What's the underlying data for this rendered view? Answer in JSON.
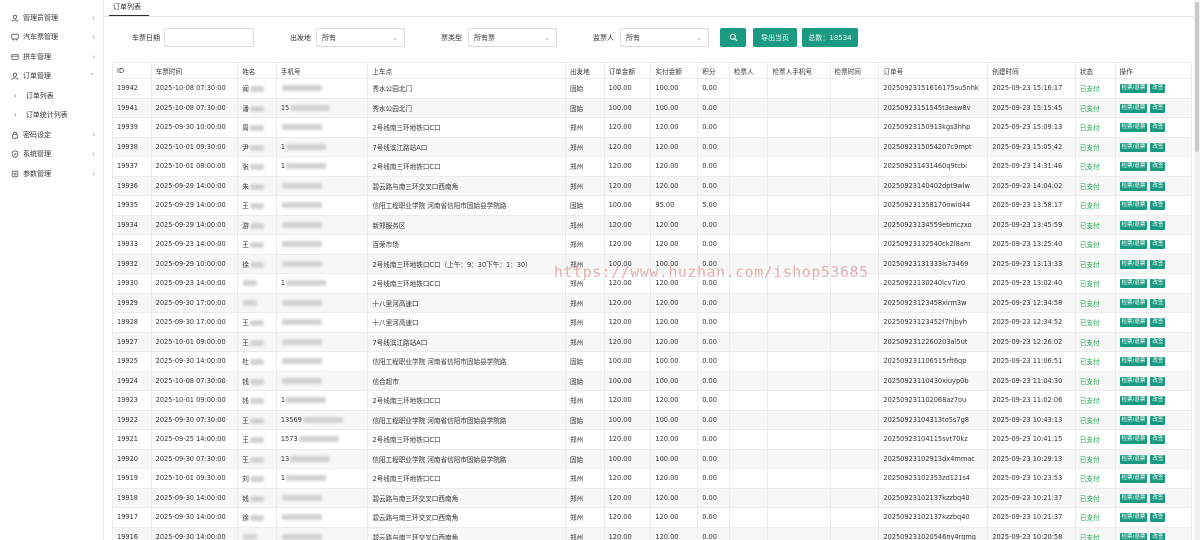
{
  "sidebar": {
    "items": [
      {
        "label": "管理员管理",
        "icon": "admin-icon",
        "arrow": "›"
      },
      {
        "label": "汽车票管理",
        "icon": "bus-icon",
        "arrow": "›"
      },
      {
        "label": "拼车管理",
        "icon": "carpool-icon",
        "arrow": "›"
      },
      {
        "label": "订单管理",
        "icon": "order-icon",
        "arrow": "⌃"
      }
    ],
    "sub_items": [
      {
        "label": "订单列表",
        "arrow": "›"
      },
      {
        "label": "订单统计列表",
        "arrow": "›"
      }
    ],
    "items_after": [
      {
        "label": "密码设定",
        "icon": "lock-icon",
        "arrow": "›"
      },
      {
        "label": "系统管理",
        "icon": "shield-icon",
        "arrow": "›"
      },
      {
        "label": "参数管理",
        "icon": "settings-icon",
        "arrow": "›"
      }
    ]
  },
  "tabs": {
    "active": "订单列表"
  },
  "filters": {
    "date_label": "车票日期",
    "origin_label": "出发地",
    "origin_value": "所有",
    "ticket_type_label": "票类型",
    "ticket_type_value": "所有票",
    "inspector_label": "监票人",
    "inspector_value": "所有",
    "export_label": "导出当页",
    "total_label": "总数：18534"
  },
  "table": {
    "columns": [
      "ID",
      "车票时间",
      "姓名",
      "手机号",
      "上车点",
      "出发地",
      "订单金额",
      "实付金额",
      "积分",
      "检票人",
      "检票人手机号",
      "检票时间",
      "订单号",
      "创建时间",
      "状态",
      "操作"
    ],
    "action_check": "检票/退票",
    "action_edit": "改签",
    "rows": [
      {
        "id": "19942",
        "time": "2025-10-08 07:30:00",
        "name": "闻",
        "phone": "",
        "stop": "秀水公园北门",
        "origin": "固始",
        "amount": "100.00",
        "paid": "100.00",
        "points": "0.00",
        "order": "20250923151616175su5nhk",
        "created": "2025-09-23 15:16:17",
        "status": "已支付"
      },
      {
        "id": "19941",
        "time": "2025-10-08 07:30:00",
        "name": "潘",
        "phone": "15",
        "stop": "秀水公园北门",
        "origin": "固始",
        "amount": "100.00",
        "paid": "100.00",
        "points": "0.00",
        "order": "2025092315154​5t3eaw8v",
        "created": "2025-09-23 15:15:45",
        "status": "已支付"
      },
      {
        "id": "19939",
        "time": "2025-09-30 10:00:00",
        "name": "周",
        "phone": "",
        "stop": "2号线南三环地铁口C口",
        "origin": "郑州",
        "amount": "120.00",
        "paid": "120.00",
        "points": "0.00",
        "order": "202509231509​13kgs3hhp",
        "created": "2025-09-23 15:09:13",
        "status": "已支付"
      },
      {
        "id": "19938",
        "time": "2025-10-01 09:30:00",
        "name": "尹",
        "phone": "1",
        "stop": "7号线滨江路站A口",
        "origin": "郑州",
        "amount": "120.00",
        "paid": "120.00",
        "points": "0.00",
        "order": "20250923150542​07c9mpt",
        "created": "2025-09-23 15:05:42",
        "status": "已支付"
      },
      {
        "id": "19937",
        "time": "2025-10-01 08:00:00",
        "name": "张",
        "phone": "1",
        "stop": "2号线南三环地铁口C口",
        "origin": "郑州",
        "amount": "120.00",
        "paid": "120.00",
        "points": "0.00",
        "order": "20250923143146​0q9tcbi",
        "created": "2025-09-23 14:31:46",
        "status": "已支付"
      },
      {
        "id": "19936",
        "time": "2025-09-29 14:00:00",
        "name": "朱",
        "phone": "",
        "stop": "碧云路与南三环交叉口西南角",
        "origin": "郑州",
        "amount": "120.00",
        "paid": "120.00",
        "points": "0.00",
        "order": "20250923140402dpt9wlw",
        "created": "2025-09-23 14:04:02",
        "status": "已支付"
      },
      {
        "id": "19935",
        "time": "2025-09-29 14:00:00",
        "name": "王",
        "phone": "",
        "stop": "信阳工程职业学院 河南省信阳市固始县学院路",
        "origin": "固始",
        "amount": "100.00",
        "paid": "95.00",
        "points": "5.00",
        "order": "20250923135817​0owid44",
        "created": "2025-09-23 13:58:17",
        "status": "已支付"
      },
      {
        "id": "19934",
        "time": "2025-09-29 14:00:00",
        "name": "游",
        "phone": "",
        "stop": "新郑服务区",
        "origin": "郑州",
        "amount": "120.00",
        "paid": "120.00",
        "points": "0.00",
        "order": "20250923134559ebmczxo",
        "created": "2025-09-23 13:45:59",
        "status": "已支付"
      },
      {
        "id": "19933",
        "time": "2025-09-23 14:00:00",
        "name": "王",
        "phone": "",
        "stop": "百荣市场",
        "origin": "郑州",
        "amount": "120.00",
        "paid": "120.00",
        "points": "0.00",
        "order": "20250923132540ck2l8am",
        "created": "2025-09-23 13:25:40",
        "status": "已支付"
      },
      {
        "id": "19932",
        "time": "2025-09-29 10:00:00",
        "name": "徐",
        "phone": "",
        "stop": "2号线南三环地铁口C口（上午：9：30下午：1：30）",
        "origin": "郑州",
        "amount": "100.00",
        "paid": "100.00",
        "points": "0.00",
        "order": "20250923131333ls73469",
        "created": "2025-09-23 13:13:33",
        "status": "已支付"
      },
      {
        "id": "19930",
        "time": "2025-09-23 14:00:00",
        "name": "",
        "phone": "1",
        "stop": "2号线南三环地铁口C口",
        "origin": "郑州",
        "amount": "120.00",
        "paid": "120.00",
        "points": "0.00",
        "order": "20250923130240lcv7lz0",
        "created": "2025-09-23 13:02:40",
        "status": "已支付"
      },
      {
        "id": "19929",
        "time": "2025-09-30 17:00:00",
        "name": "",
        "phone": "",
        "stop": "十八里河高速口",
        "origin": "郑州",
        "amount": "120.00",
        "paid": "120.00",
        "points": "0.00",
        "order": "20250923123458xirm3w",
        "created": "2025-09-23 12:34:58",
        "status": "已支付"
      },
      {
        "id": "19928",
        "time": "2025-09-30 17:00:00",
        "name": "王",
        "phone": "",
        "stop": "十八里河高速口",
        "origin": "郑州",
        "amount": "120.00",
        "paid": "120.00",
        "points": "0.00",
        "order": "20250923123452f7hjbyh",
        "created": "2025-09-23 12:34:52",
        "status": "已支付"
      },
      {
        "id": "19927",
        "time": "2025-10-01 09:00:00",
        "name": "王",
        "phone": "",
        "stop": "7号线滨江路站A口",
        "origin": "郑州",
        "amount": "120.00",
        "paid": "120.00",
        "points": "0.00",
        "order": "20250923122602​03al5ut",
        "created": "2025-09-23 12:26:02",
        "status": "已支付"
      },
      {
        "id": "19925",
        "time": "2025-09-30 14:00:00",
        "name": "杜",
        "phone": "",
        "stop": "信阳工程职业学院 河南省信阳市固始县学院路",
        "origin": "固始",
        "amount": "100.00",
        "paid": "100.00",
        "points": "0.00",
        "order": "20250923110651​5rft6qp",
        "created": "2025-09-23 11:06:51",
        "status": "已支付"
      },
      {
        "id": "19924",
        "time": "2025-10-08 07:30:00",
        "name": "钱",
        "phone": "",
        "stop": "信合超市",
        "origin": "固始",
        "amount": "100.00",
        "paid": "100.00",
        "points": "0.00",
        "order": "20250923110430xiuyp0b",
        "created": "2025-09-23 11:04:30",
        "status": "已支付"
      },
      {
        "id": "19923",
        "time": "2025-10-01 09:00:00",
        "name": "钱",
        "phone": "1",
        "stop": "2号线南三环地铁口C口",
        "origin": "郑州",
        "amount": "120.00",
        "paid": "120.00",
        "points": "0.00",
        "order": "20250923110206​8az7ou",
        "created": "2025-09-23 11:02:06",
        "status": "已支付"
      },
      {
        "id": "19922",
        "time": "2025-09-30 07:30:00",
        "name": "王",
        "phone": "13569",
        "stop": "信阳工程职业学院 河南省信阳市固始县学院路",
        "origin": "固始",
        "amount": "100.00",
        "paid": "100.00",
        "points": "0.00",
        "order": "20250923104313to5s7g8",
        "created": "2025-09-23 10:43:13",
        "status": "已支付"
      },
      {
        "id": "19921",
        "time": "2025-09-25 14:00:00",
        "name": "王",
        "phone": "1573",
        "stop": "2号线南三环地铁口C口",
        "origin": "郑州",
        "amount": "120.00",
        "paid": "120.00",
        "points": "0.00",
        "order": "20250923104115svt70kz",
        "created": "2025-09-23 10:41:15",
        "status": "已支付"
      },
      {
        "id": "19920",
        "time": "2025-09-30 07:30:00",
        "name": "王",
        "phone": "13",
        "stop": "信阳工程职业学院 河南省信阳市固始县学院路",
        "origin": "固始",
        "amount": "100.00",
        "paid": "100.00",
        "points": "0.00",
        "order": "20250923102913dx4mmac",
        "created": "2025-09-23 10:29:13",
        "status": "已支付"
      },
      {
        "id": "19919",
        "time": "2025-10-01 09:30:00",
        "name": "刘",
        "phone": "1",
        "stop": "2号线南三环地铁口C口",
        "origin": "郑州",
        "amount": "120.00",
        "paid": "120.00",
        "points": "0.00",
        "order": "20250923102353zd121s4",
        "created": "2025-09-23 10:23:53",
        "status": "已支付"
      },
      {
        "id": "19918",
        "time": "2025-09-30 14:00:00",
        "name": "钱",
        "phone": "",
        "stop": "碧云路与南三环交叉口西南角",
        "origin": "郑州",
        "amount": "120.00",
        "paid": "120.00",
        "points": "0.00",
        "order": "20250923102137kzzbq40",
        "created": "2025-09-23 10:21:37",
        "status": "已支付"
      },
      {
        "id": "19917",
        "time": "2025-09-30 14:00:00",
        "name": "徐",
        "phone": "",
        "stop": "碧云路与南三环交叉口西南角",
        "origin": "郑州",
        "amount": "120.00",
        "paid": "120.00",
        "points": "0.00",
        "order": "20250923102137kzzbq40",
        "created": "2025-09-23 10:21:37",
        "status": "已支付"
      },
      {
        "id": "19916",
        "time": "2025-09-30 14:00:00",
        "name": "",
        "phone": "",
        "stop": "碧云路与南三环交叉口西南角",
        "origin": "郑州",
        "amount": "120.00",
        "paid": "120.00",
        "points": "0.00",
        "order": "20250923102054​6ny4rqmg",
        "created": "2025-09-23 10:20:58",
        "status": "已支付"
      }
    ]
  },
  "watermark": "https://www.huzhan.com/ishop53685",
  "colors": {
    "accent": "#1a9a81",
    "paid": "#1aa34a"
  }
}
